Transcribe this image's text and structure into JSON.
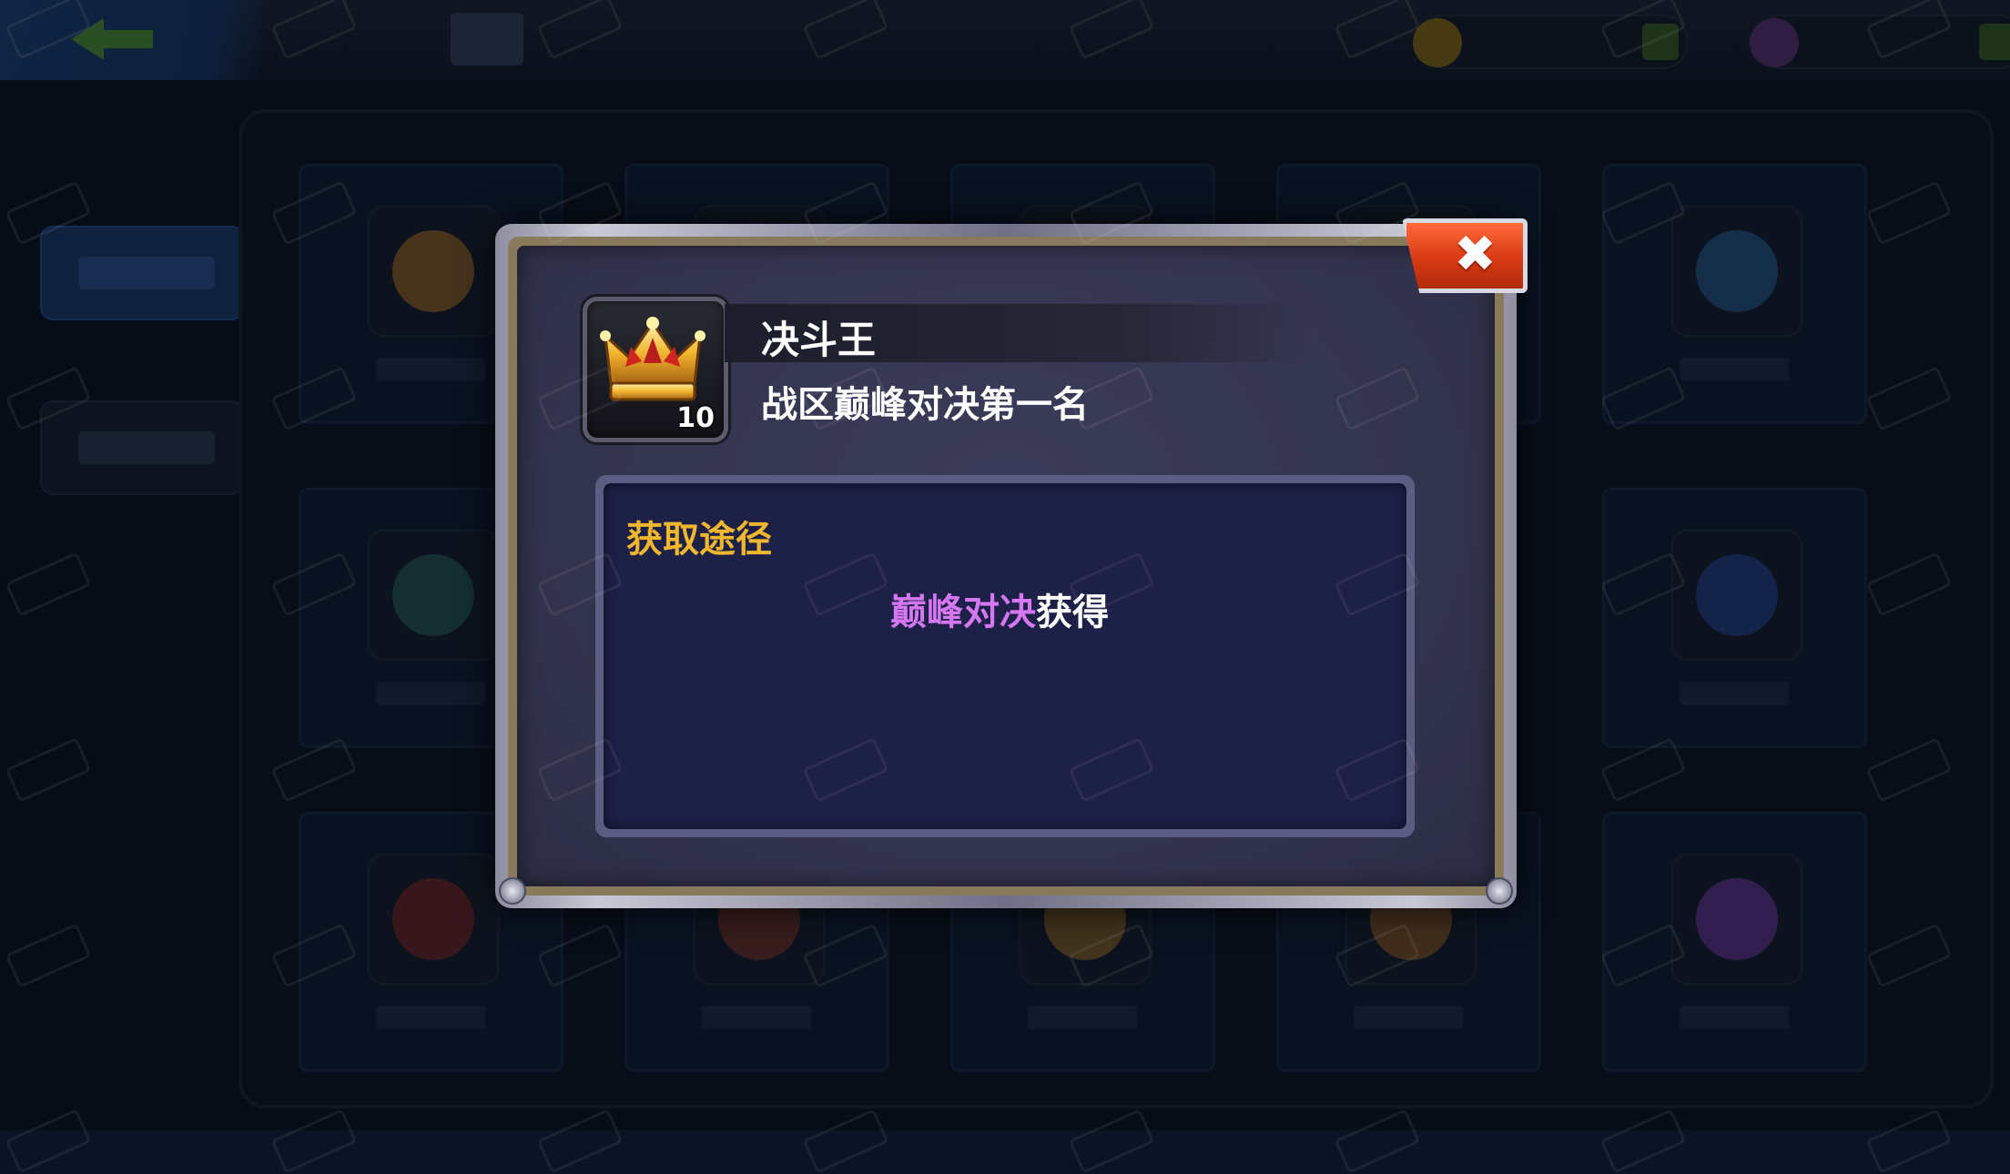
{
  "dialog": {
    "item_name": "决斗王",
    "item_description": "战区巅峰对决第一名",
    "badge_level": "10",
    "close_symbol": "✖",
    "source_section_title": "获取途径",
    "source_link_text": "巅峰对决",
    "source_suffix_text": "获得"
  },
  "colors": {
    "source_title": "#f0b62e",
    "source_link": "#d677f2",
    "close_button": "#e0441c",
    "panel": "#1d2047"
  },
  "icons": {
    "badge": "crown-icon",
    "close": "close-icon",
    "back": "back-arrow-icon"
  }
}
